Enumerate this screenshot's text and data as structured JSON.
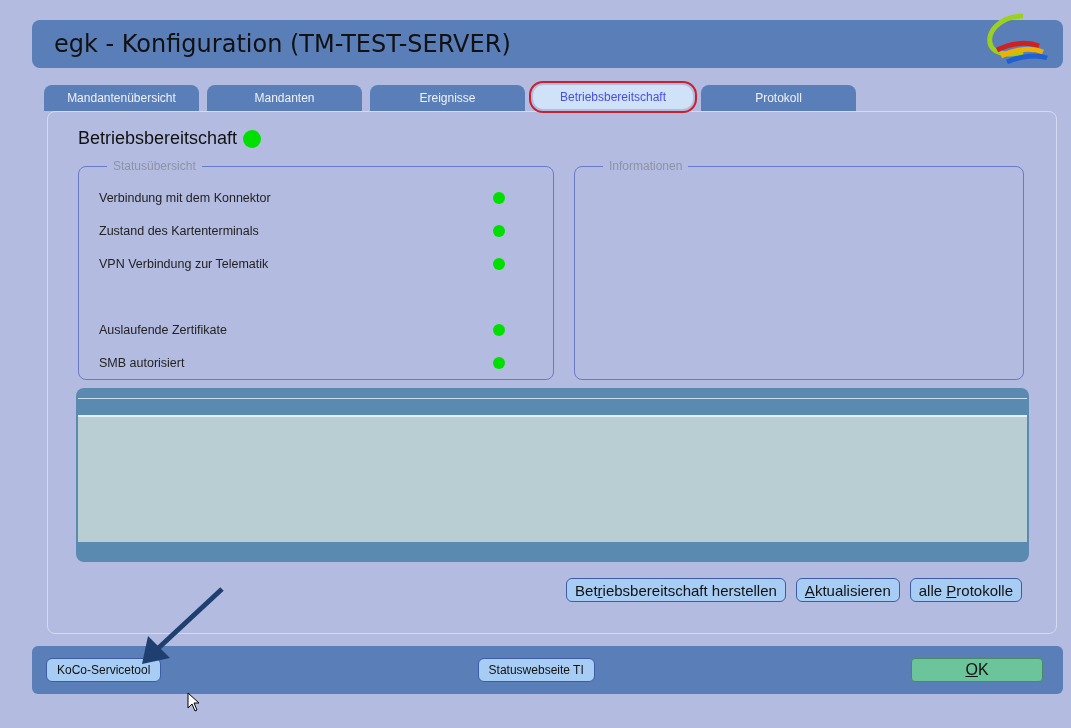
{
  "window": {
    "title": "egk - Konfiguration (TM-TEST-SERVER)"
  },
  "tabs": [
    {
      "label": "Mandantenübersicht",
      "selected": false
    },
    {
      "label": "Mandanten",
      "selected": false
    },
    {
      "label": "Ereignisse",
      "selected": false
    },
    {
      "label": "Betriebsbereitschaft",
      "selected": true
    },
    {
      "label": "Protokoll",
      "selected": false
    }
  ],
  "heading": {
    "text": "Betriebsbereitschaft",
    "color": "#00e000"
  },
  "status_overview": {
    "legend": "Statusübersicht",
    "items": [
      {
        "kind": "status",
        "label": "Verbindung mit dem Konnektor",
        "color": "#00e000"
      },
      {
        "kind": "status",
        "label": "Zustand des Kartenterminals",
        "color": "#00e000"
      },
      {
        "kind": "status",
        "label": "VPN Verbindung zur Telematik",
        "color": "#00e000"
      },
      {
        "kind": "gap"
      },
      {
        "kind": "status",
        "label": "Auslaufende Zertifikate",
        "color": "#00e000"
      },
      {
        "kind": "status",
        "label": "SMB autorisiert",
        "color": "#00e000"
      }
    ]
  },
  "information": {
    "legend": "Informationen"
  },
  "actions": [
    {
      "before": "Bet",
      "key": "r",
      "after": "iebsbereitschaft herstellen"
    },
    {
      "key": "A",
      "after": "ktualisieren"
    },
    {
      "before": "alle ",
      "key": "P",
      "after": "rotokolle"
    }
  ],
  "footer": {
    "left_button": "KoCo-Servicetool",
    "center_button": "Statuswebseite TI",
    "ok_button": {
      "key": "O",
      "after": "K"
    }
  }
}
